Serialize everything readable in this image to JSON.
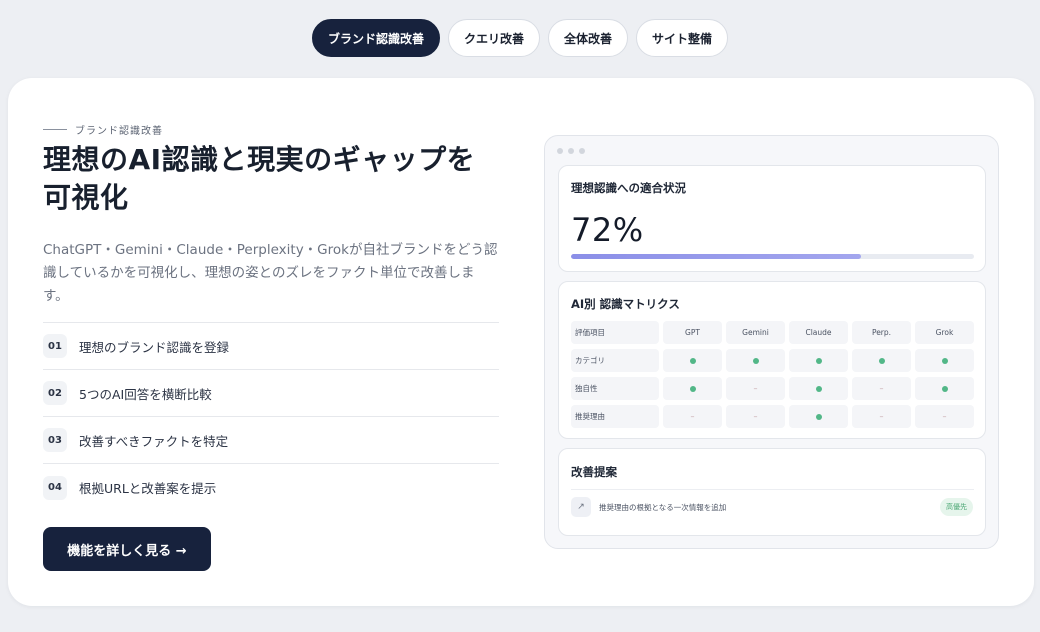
{
  "tabs": [
    {
      "label": "ブランド認識改善",
      "active": true
    },
    {
      "label": "クエリ改善",
      "active": false
    },
    {
      "label": "全体改善",
      "active": false
    },
    {
      "label": "サイト整備",
      "active": false
    }
  ],
  "hero": {
    "eyebrow": "ブランド認識改善",
    "headline_line1": "理想のAI認識と現実のギャップを",
    "headline_line2": "可視化",
    "lead": "ChatGPT・Gemini・Claude・Perplexity・Grokが自社ブランドをどう認識しているかを可視化し、理想の姿とのズレをファクト単位で改善します。",
    "steps": [
      {
        "num": "01",
        "text": "理想のブランド認識を登録"
      },
      {
        "num": "02",
        "text": "5つのAI回答を横断比較"
      },
      {
        "num": "03",
        "text": "改善すべきファクトを特定"
      },
      {
        "num": "04",
        "text": "根拠URLと改善案を提示"
      }
    ],
    "cta": "機能を詳しく見る →"
  },
  "mock": {
    "fit": {
      "title": "理想認識への適合状況",
      "value": "72%",
      "progress": 0.72
    },
    "matrix": {
      "title": "AI別 認識マトリクス",
      "headers": [
        "評価項目",
        "GPT",
        "Gemini",
        "Claude",
        "Perp.",
        "Grok"
      ],
      "rows": [
        {
          "label": "カテゴリ",
          "cells": [
            "ok",
            "ok",
            "ok",
            "ok",
            "ok"
          ]
        },
        {
          "label": "独自性",
          "cells": [
            "ok",
            "–",
            "ok",
            "–",
            "ok"
          ]
        },
        {
          "label": "推奨理由",
          "cells": [
            "–",
            "–",
            "ok",
            "–",
            "–"
          ]
        }
      ]
    },
    "suggest": {
      "title": "改善提案",
      "icon": "↗",
      "text": "推奨理由の根拠となる一次情報を追加",
      "badge": "高優先"
    }
  },
  "colors": {
    "navy": "#17223d",
    "green": "#52b788",
    "accent": "#8b8fe8"
  }
}
